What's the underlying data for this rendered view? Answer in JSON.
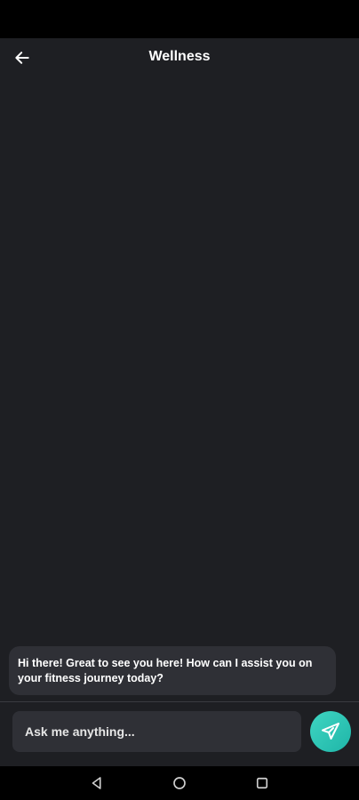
{
  "app_bar": {
    "title": "Wellness",
    "back_icon": "arrow-left-icon"
  },
  "chat": {
    "messages": [
      {
        "sender": "bot",
        "text": "Hi there! Great to see you here! How can I assist you on your fitness journey today?"
      }
    ]
  },
  "composer": {
    "placeholder": "Ask me anything...",
    "send_icon": "send-icon",
    "send_color": "#2cc8b8"
  },
  "nav": {
    "back_icon": "triangle-back-icon",
    "home_icon": "circle-home-icon",
    "recents_icon": "square-recents-icon"
  },
  "colors": {
    "background": "#1e1f23",
    "bubble": "#2f3036",
    "text": "#ffffff"
  }
}
